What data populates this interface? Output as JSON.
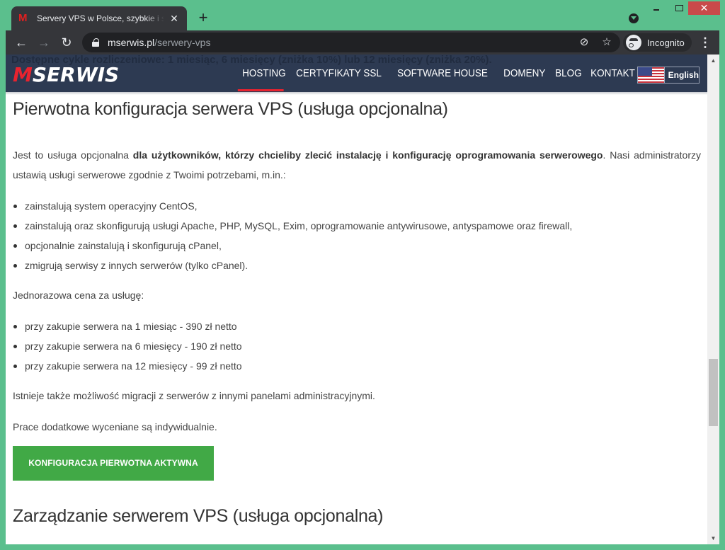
{
  "browser": {
    "tab_title": "Servery VPS w Polsce, szybkie i stabilne",
    "tab_favicon": "M",
    "new_tab_symbol": "+",
    "url_host": "mserwis.pl",
    "url_path": "/serwery-vps",
    "incognito_label": "Incognito",
    "icons": {
      "back": "←",
      "forward": "→",
      "reload": "↻",
      "eye_off": "⊘",
      "star": "☆",
      "menu": "⋮",
      "close_tab": "✕",
      "window_close": "✕",
      "scroll_up": "▲",
      "scroll_down": "▼"
    }
  },
  "site": {
    "ghost_text": "Dostępne cykle rozliczeniowe: 1 miesiąc, 6 miesięcy (zniżka 10%) lub 12 miesięcy (zniżka 20%).",
    "logo_m": "M",
    "logo_rest": "SERWIS",
    "nav": [
      {
        "label": "HOSTING",
        "active": true
      },
      {
        "label": "CERTYFIKATY SSL",
        "active": false
      },
      {
        "label": "SOFTWARE HOUSE",
        "active": false
      },
      {
        "label": "DOMENY",
        "active": false
      },
      {
        "label": "BLOG",
        "active": false
      },
      {
        "label": "KONTAKT",
        "active": false
      }
    ],
    "language_label": "English",
    "accent_color": "#e8232f",
    "header_color": "#2d3a52",
    "cta_color": "#41a946"
  },
  "content": {
    "heading_1": "Pierwotna konfiguracja serwera VPS (usługa opcjonalna)",
    "intro_start": "Jest to usługa opcjonalna ",
    "intro_bold": "dla użytkowników, którzy chcieliby zlecić instalację i konfigurację oprogramowania serwerowego",
    "intro_end": ". Nasi administratorzy ustawią usługi serwerowe zgodnie z Twoimi potrzebami, m.in.:",
    "services": [
      "zainstalują system operacyjny CentOS,",
      "zainstalują oraz skonfigurują usługi Apache, PHP, MySQL, Exim, oprogramowanie antywirusowe, antyspamowe oraz firewall,",
      "opcjonalnie zainstalują i skonfigurują cPanel,",
      "zmigrują serwisy z innych serwerów (tylko cPanel)."
    ],
    "price_intro": "Jednorazowa cena za usługę:",
    "prices": [
      "przy zakupie serwera na 1 miesiąc - 390 zł netto",
      "przy zakupie serwera na 6 miesięcy - 190 zł netto",
      "przy zakupie serwera na 12 miesięcy - 99 zł netto"
    ],
    "migration_note": "Istnieje także możliwość migracji z serwerów z innymi panelami administracyjnymi.",
    "extra_note": "Prace dodatkowe wyceniane są indywidualnie.",
    "cta_label": "KONFIGURACJA PIERWOTNA AKTYWNA",
    "heading_2": "Zarządzanie serwerem VPS (usługa opcjonalna)"
  }
}
